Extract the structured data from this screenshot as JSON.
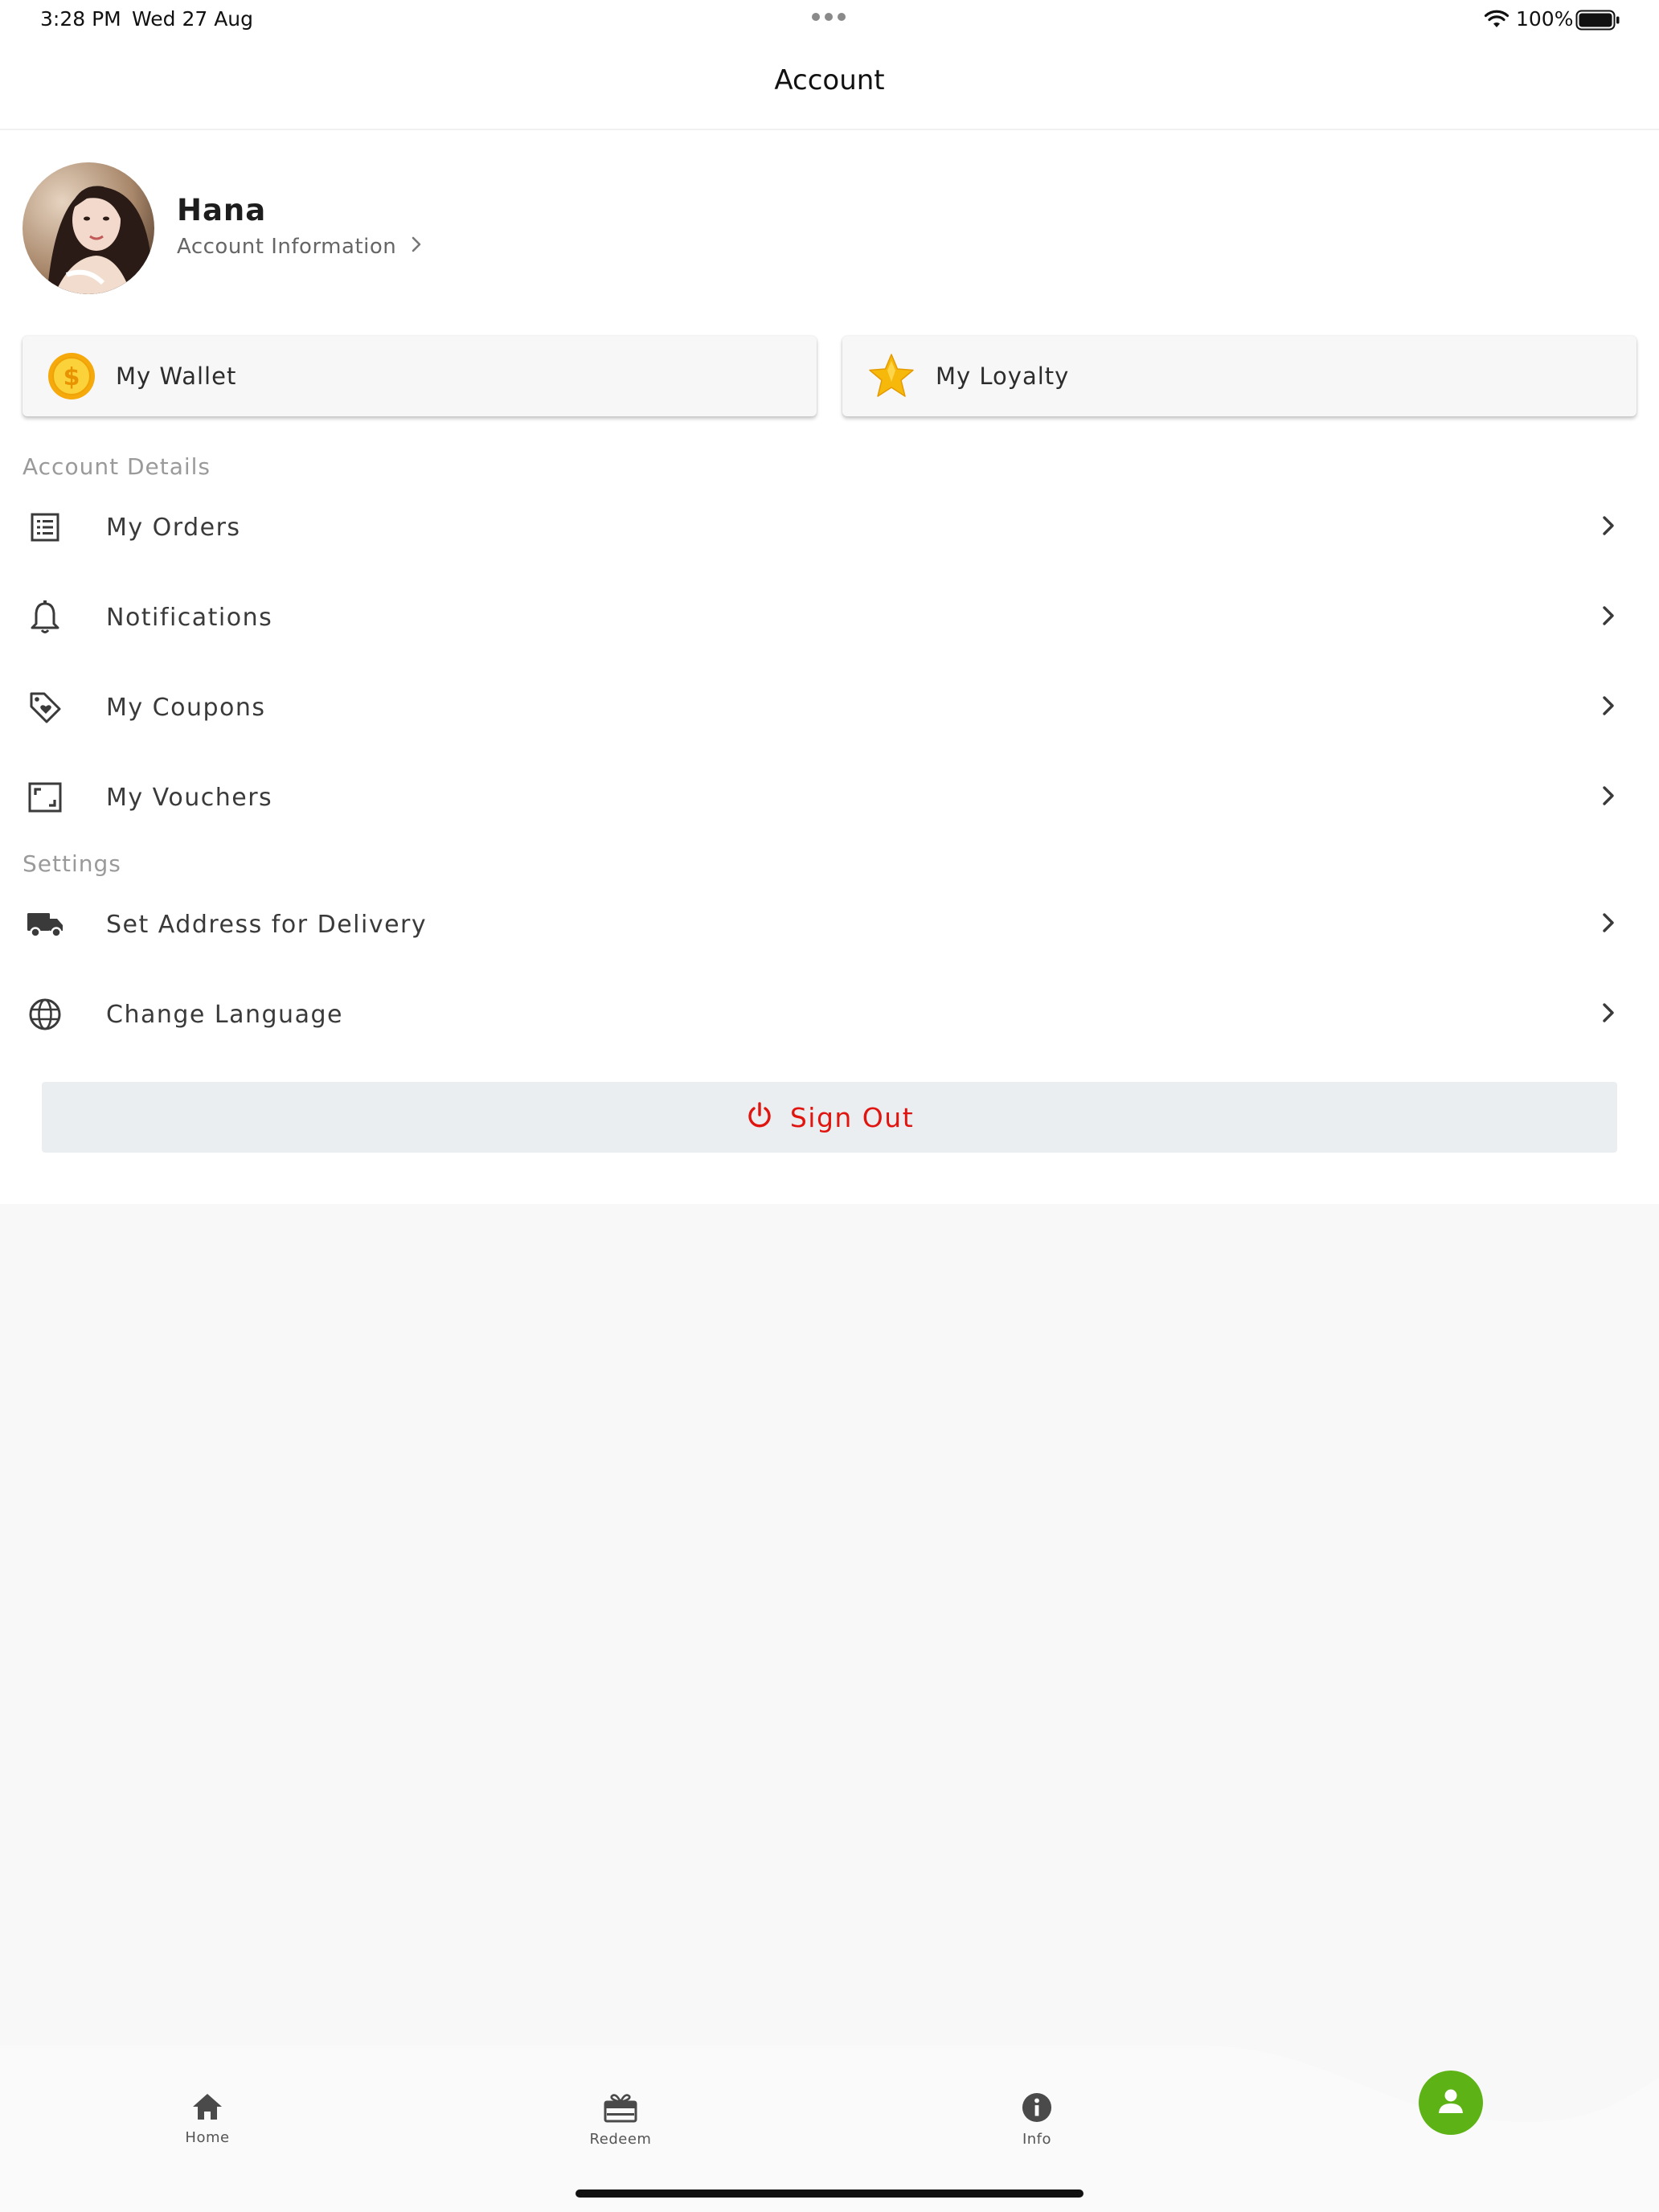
{
  "status_bar": {
    "time": "3:28 PM",
    "date": "Wed 27 Aug",
    "battery": "100%"
  },
  "header": {
    "title": "Account"
  },
  "profile": {
    "name": "Hana",
    "account_link": "Account Information"
  },
  "cards": {
    "wallet": {
      "label": "My Wallet",
      "icon": "coin-icon"
    },
    "loyalty": {
      "label": "My Loyalty",
      "icon": "star-icon"
    }
  },
  "account_details": {
    "heading": "Account Details",
    "items": [
      {
        "label": "My Orders",
        "icon": "list-icon"
      },
      {
        "label": "Notifications",
        "icon": "bell-icon"
      },
      {
        "label": "My Coupons",
        "icon": "tag-icon"
      },
      {
        "label": "My Vouchers",
        "icon": "voucher-icon"
      }
    ]
  },
  "settings": {
    "heading": "Settings",
    "items": [
      {
        "label": "Set Address for Delivery",
        "icon": "truck-icon"
      },
      {
        "label": "Change Language",
        "icon": "globe-icon"
      }
    ]
  },
  "sign_out": {
    "label": "Sign Out",
    "color": "#e0150f"
  },
  "bottom_nav": {
    "items": [
      {
        "label": "Home",
        "icon": "home-icon"
      },
      {
        "label": "Redeem",
        "icon": "gift-icon"
      },
      {
        "label": "Info",
        "icon": "info-icon"
      }
    ],
    "active": {
      "icon": "person-icon",
      "color": "#5db316"
    }
  }
}
